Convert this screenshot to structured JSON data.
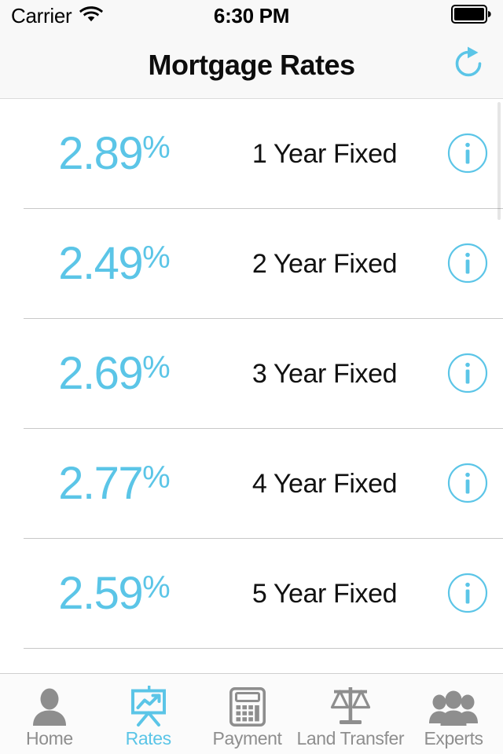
{
  "status_bar": {
    "carrier": "Carrier",
    "wifi_icon": "wifi-icon",
    "time": "6:30 PM",
    "battery_icon": "battery-full-icon"
  },
  "nav_bar": {
    "title": "Mortgage Rates",
    "refresh_icon": "refresh-icon"
  },
  "colors": {
    "accent": "#5BC5E7",
    "text": "#111111",
    "muted": "#8E8E8E",
    "separator": "#C8C8C8",
    "bar_background": "#F8F8F8"
  },
  "rates": [
    {
      "value": "2.89",
      "percent": "%",
      "term": "1 Year Fixed",
      "info_icon": "info-circle-icon"
    },
    {
      "value": "2.49",
      "percent": "%",
      "term": "2 Year Fixed",
      "info_icon": "info-circle-icon"
    },
    {
      "value": "2.69",
      "percent": "%",
      "term": "3 Year Fixed",
      "info_icon": "info-circle-icon"
    },
    {
      "value": "2.77",
      "percent": "%",
      "term": "4 Year Fixed",
      "info_icon": "info-circle-icon"
    },
    {
      "value": "2.59",
      "percent": "%",
      "term": "5 Year Fixed",
      "info_icon": "info-circle-icon"
    }
  ],
  "tab_bar": {
    "items": [
      {
        "label": "Home",
        "icon": "person-icon",
        "active": false
      },
      {
        "label": "Rates",
        "icon": "presentation-chart-icon",
        "active": true
      },
      {
        "label": "Payment",
        "icon": "calculator-icon",
        "active": false
      },
      {
        "label": "Land Transfer",
        "icon": "scales-icon",
        "active": false
      },
      {
        "label": "Experts",
        "icon": "people-group-icon",
        "active": false
      }
    ]
  }
}
